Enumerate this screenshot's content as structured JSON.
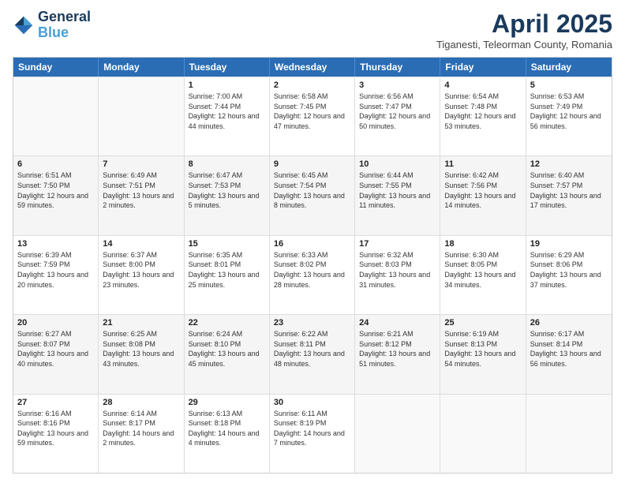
{
  "logo": {
    "line1": "General",
    "line2": "Blue"
  },
  "header": {
    "month": "April 2025",
    "location": "Tiganesti, Teleorman County, Romania"
  },
  "weekdays": [
    "Sunday",
    "Monday",
    "Tuesday",
    "Wednesday",
    "Thursday",
    "Friday",
    "Saturday"
  ],
  "rows": [
    [
      {
        "day": "",
        "info": ""
      },
      {
        "day": "",
        "info": ""
      },
      {
        "day": "1",
        "info": "Sunrise: 7:00 AM\nSunset: 7:44 PM\nDaylight: 12 hours and 44 minutes."
      },
      {
        "day": "2",
        "info": "Sunrise: 6:58 AM\nSunset: 7:45 PM\nDaylight: 12 hours and 47 minutes."
      },
      {
        "day": "3",
        "info": "Sunrise: 6:56 AM\nSunset: 7:47 PM\nDaylight: 12 hours and 50 minutes."
      },
      {
        "day": "4",
        "info": "Sunrise: 6:54 AM\nSunset: 7:48 PM\nDaylight: 12 hours and 53 minutes."
      },
      {
        "day": "5",
        "info": "Sunrise: 6:53 AM\nSunset: 7:49 PM\nDaylight: 12 hours and 56 minutes."
      }
    ],
    [
      {
        "day": "6",
        "info": "Sunrise: 6:51 AM\nSunset: 7:50 PM\nDaylight: 12 hours and 59 minutes."
      },
      {
        "day": "7",
        "info": "Sunrise: 6:49 AM\nSunset: 7:51 PM\nDaylight: 13 hours and 2 minutes."
      },
      {
        "day": "8",
        "info": "Sunrise: 6:47 AM\nSunset: 7:53 PM\nDaylight: 13 hours and 5 minutes."
      },
      {
        "day": "9",
        "info": "Sunrise: 6:45 AM\nSunset: 7:54 PM\nDaylight: 13 hours and 8 minutes."
      },
      {
        "day": "10",
        "info": "Sunrise: 6:44 AM\nSunset: 7:55 PM\nDaylight: 13 hours and 11 minutes."
      },
      {
        "day": "11",
        "info": "Sunrise: 6:42 AM\nSunset: 7:56 PM\nDaylight: 13 hours and 14 minutes."
      },
      {
        "day": "12",
        "info": "Sunrise: 6:40 AM\nSunset: 7:57 PM\nDaylight: 13 hours and 17 minutes."
      }
    ],
    [
      {
        "day": "13",
        "info": "Sunrise: 6:39 AM\nSunset: 7:59 PM\nDaylight: 13 hours and 20 minutes."
      },
      {
        "day": "14",
        "info": "Sunrise: 6:37 AM\nSunset: 8:00 PM\nDaylight: 13 hours and 23 minutes."
      },
      {
        "day": "15",
        "info": "Sunrise: 6:35 AM\nSunset: 8:01 PM\nDaylight: 13 hours and 25 minutes."
      },
      {
        "day": "16",
        "info": "Sunrise: 6:33 AM\nSunset: 8:02 PM\nDaylight: 13 hours and 28 minutes."
      },
      {
        "day": "17",
        "info": "Sunrise: 6:32 AM\nSunset: 8:03 PM\nDaylight: 13 hours and 31 minutes."
      },
      {
        "day": "18",
        "info": "Sunrise: 6:30 AM\nSunset: 8:05 PM\nDaylight: 13 hours and 34 minutes."
      },
      {
        "day": "19",
        "info": "Sunrise: 6:29 AM\nSunset: 8:06 PM\nDaylight: 13 hours and 37 minutes."
      }
    ],
    [
      {
        "day": "20",
        "info": "Sunrise: 6:27 AM\nSunset: 8:07 PM\nDaylight: 13 hours and 40 minutes."
      },
      {
        "day": "21",
        "info": "Sunrise: 6:25 AM\nSunset: 8:08 PM\nDaylight: 13 hours and 43 minutes."
      },
      {
        "day": "22",
        "info": "Sunrise: 6:24 AM\nSunset: 8:10 PM\nDaylight: 13 hours and 45 minutes."
      },
      {
        "day": "23",
        "info": "Sunrise: 6:22 AM\nSunset: 8:11 PM\nDaylight: 13 hours and 48 minutes."
      },
      {
        "day": "24",
        "info": "Sunrise: 6:21 AM\nSunset: 8:12 PM\nDaylight: 13 hours and 51 minutes."
      },
      {
        "day": "25",
        "info": "Sunrise: 6:19 AM\nSunset: 8:13 PM\nDaylight: 13 hours and 54 minutes."
      },
      {
        "day": "26",
        "info": "Sunrise: 6:17 AM\nSunset: 8:14 PM\nDaylight: 13 hours and 56 minutes."
      }
    ],
    [
      {
        "day": "27",
        "info": "Sunrise: 6:16 AM\nSunset: 8:16 PM\nDaylight: 13 hours and 59 minutes."
      },
      {
        "day": "28",
        "info": "Sunrise: 6:14 AM\nSunset: 8:17 PM\nDaylight: 14 hours and 2 minutes."
      },
      {
        "day": "29",
        "info": "Sunrise: 6:13 AM\nSunset: 8:18 PM\nDaylight: 14 hours and 4 minutes."
      },
      {
        "day": "30",
        "info": "Sunrise: 6:11 AM\nSunset: 8:19 PM\nDaylight: 14 hours and 7 minutes."
      },
      {
        "day": "",
        "info": ""
      },
      {
        "day": "",
        "info": ""
      },
      {
        "day": "",
        "info": ""
      }
    ]
  ]
}
